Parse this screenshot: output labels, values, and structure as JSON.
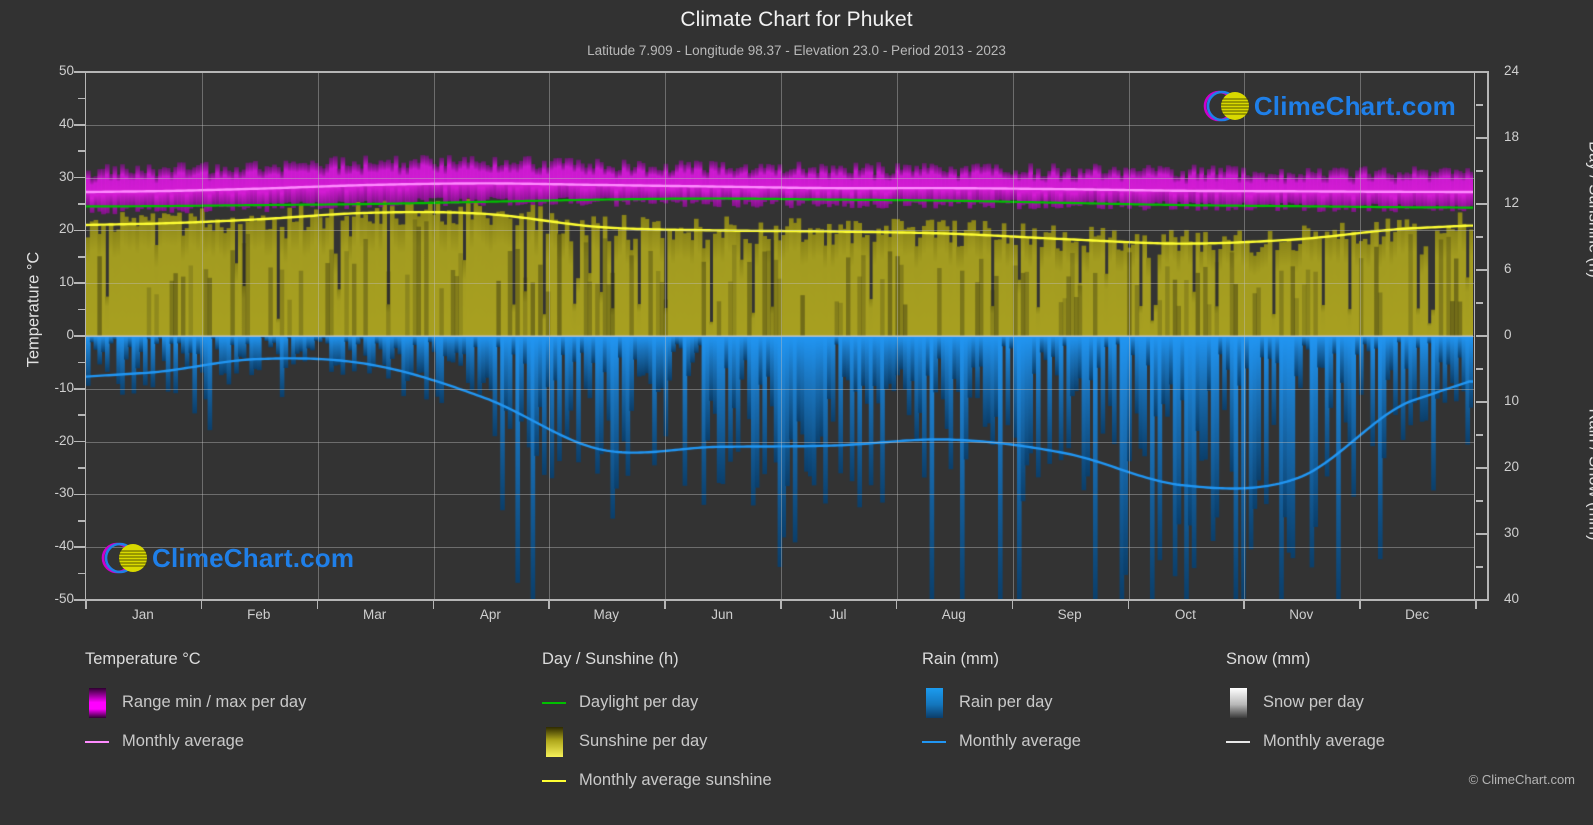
{
  "header": {
    "title": "Climate Chart for Phuket",
    "subtitle": "Latitude 7.909 - Longitude 98.37 - Elevation 23.0 - Period 2013 - 2023"
  },
  "axes": {
    "left_title": "Temperature °C",
    "right_title_top": "Day / Sunshine (h)",
    "right_title_bottom": "Rain / Snow (mm)",
    "left_ticks": [
      "50",
      "40",
      "30",
      "20",
      "10",
      "0",
      "-10",
      "-20",
      "-30",
      "-40",
      "-50"
    ],
    "right_ticks_top": [
      "24",
      "18",
      "12",
      "6",
      "0"
    ],
    "right_ticks_bottom": [
      "10",
      "20",
      "30",
      "40"
    ],
    "x_ticks": [
      "Jan",
      "Feb",
      "Mar",
      "Apr",
      "May",
      "Jun",
      "Jul",
      "Aug",
      "Sep",
      "Oct",
      "Nov",
      "Dec"
    ]
  },
  "legend": {
    "groups": [
      {
        "heading": "Temperature °C",
        "entries": [
          {
            "label": "Range min / max per day",
            "swatch": "magenta-gradient-box"
          },
          {
            "label": "Monthly average",
            "swatch": "magenta-line"
          }
        ]
      },
      {
        "heading": "Day / Sunshine (h)",
        "entries": [
          {
            "label": "Daylight per day",
            "swatch": "green-line"
          },
          {
            "label": "Sunshine per day",
            "swatch": "yellow-gradient-box"
          },
          {
            "label": "Monthly average sunshine",
            "swatch": "yellow-line"
          }
        ]
      },
      {
        "heading": "Rain (mm)",
        "entries": [
          {
            "label": "Rain per day",
            "swatch": "blue-gradient-box"
          },
          {
            "label": "Monthly average",
            "swatch": "blue-line"
          }
        ]
      },
      {
        "heading": "Snow (mm)",
        "entries": [
          {
            "label": "Snow per day",
            "swatch": "white-gradient-box"
          },
          {
            "label": "Monthly average",
            "swatch": "white-line"
          }
        ]
      }
    ]
  },
  "watermark": {
    "text": "ClimeChart.com"
  },
  "copyright": "© ClimeChart.com",
  "colors": {
    "background": "#323232",
    "plot_background": "#333333",
    "grid": "#bebebe",
    "temp_range": "#d41cd4",
    "temp_avg_line": "#ff8cff",
    "daylight_line": "#00c000",
    "sunshine_fill": "#a8a020",
    "sunshine_avg_line": "#ffff33",
    "rain_fill": "#1f7fc0",
    "rain_avg_line": "#2196f3",
    "snow_fill": "#e0e0e0",
    "text": "#d8d8d8",
    "brand_blue": "#1f7fe8",
    "brand_magenta": "#e000e0",
    "brand_yellow": "#d8d800"
  },
  "chart_data": {
    "type": "area",
    "title": "Climate Chart for Phuket",
    "subtitle": "Latitude 7.909 - Longitude 98.37 - Elevation 23.0 - Period 2013 - 2023",
    "xlabel": "",
    "ylabel": "Temperature °C",
    "ylim": [
      -50,
      50
    ],
    "y2lim_top": [
      0,
      24
    ],
    "y2lim_bottom": [
      0,
      40
    ],
    "grid": true,
    "legend_position": "below",
    "categories": [
      "Jan",
      "Feb",
      "Mar",
      "Apr",
      "May",
      "Jun",
      "Jul",
      "Aug",
      "Sep",
      "Oct",
      "Nov",
      "Dec"
    ],
    "series": [
      {
        "name": "Monthly average temperature (°C)",
        "unit": "°C",
        "values": [
          27.4,
          27.9,
          28.6,
          28.9,
          28.6,
          28.3,
          28.0,
          28.0,
          27.8,
          27.5,
          27.4,
          27.3
        ]
      },
      {
        "name": "Daily max temperature (°C)",
        "unit": "°C",
        "values": [
          31.5,
          32.2,
          33.0,
          33.2,
          32.4,
          32.0,
          31.7,
          31.6,
          31.4,
          31.2,
          31.2,
          31.2
        ]
      },
      {
        "name": "Daily min temperature (°C)",
        "unit": "°C",
        "values": [
          24.0,
          24.3,
          25.0,
          25.5,
          25.4,
          25.2,
          25.0,
          25.0,
          24.8,
          24.6,
          24.4,
          24.2
        ]
      },
      {
        "name": "Daylight per day (h)",
        "unit": "h",
        "values": [
          11.8,
          11.9,
          12.0,
          12.2,
          12.4,
          12.5,
          12.4,
          12.3,
          12.1,
          11.9,
          11.8,
          11.7
        ]
      },
      {
        "name": "Monthly average sunshine (h)",
        "unit": "h",
        "values": [
          10.2,
          10.6,
          11.2,
          11.1,
          9.9,
          9.6,
          9.5,
          9.3,
          8.8,
          8.4,
          8.8,
          9.8
        ]
      },
      {
        "name": "Monthly average rain (mm/day)",
        "unit": "mm",
        "values": [
          5.6,
          3.5,
          4.3,
          9.4,
          17.2,
          16.8,
          16.6,
          15.7,
          17.8,
          22.6,
          21.5,
          9.7
        ]
      },
      {
        "name": "Monthly average snow (mm/day)",
        "unit": "mm",
        "values": [
          0,
          0,
          0,
          0,
          0,
          0,
          0,
          0,
          0,
          0,
          0,
          0
        ]
      }
    ]
  }
}
